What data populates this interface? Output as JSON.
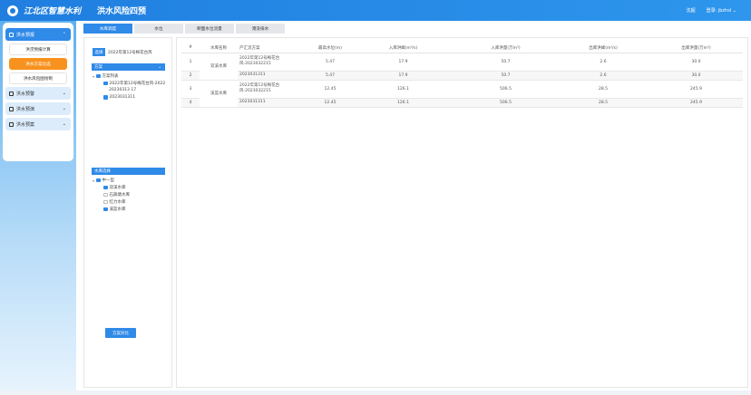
{
  "header": {
    "brand": "江北区智慧水利",
    "system": "洪水风险四预",
    "user_label": "沈超",
    "logout": "登录: jbzhsl"
  },
  "sidebar": [
    {
      "label": "洪水预报",
      "children": [
        "洪涝预报计算",
        "洪水方案比选",
        "洪水风险图绘制"
      ]
    },
    {
      "label": "洪水预警"
    },
    {
      "label": "洪水预演"
    },
    {
      "label": "洪水预案"
    }
  ],
  "tabs": [
    "水库调度",
    "水位",
    "断面水位流量",
    "淹没排水"
  ],
  "left": {
    "select_btn": "选择",
    "select_value": "2022年第12号梅花台风",
    "section1": "方案",
    "tree1_root": "方案列表",
    "tree1_items": [
      "2022年第12号梅花台风-2022",
      "20230313 17",
      "2023031311"
    ],
    "section2": "水库选择",
    "tree2_root": "中一型",
    "tree2_items": [
      "双溪水库",
      "石蔬塘水库",
      "红力水库",
      "溪篮水库"
    ],
    "compare_button": "方案对比"
  },
  "table": {
    "headers": [
      "#",
      "水库名称",
      "产汇流方案",
      "最高水位(m)",
      "入库洪峰(m³/s)",
      "入库洪量(万m³)",
      "出库洪峰(m³/s)",
      "出库洪量(万m³)"
    ],
    "rows": [
      {
        "idx": "1",
        "reservoir": "双溪水库",
        "scheme": "2022年第12号梅花台风-2023032215",
        "max_level": "5.47",
        "in_peak": "17.9",
        "in_vol": "50.7",
        "out_peak": "2.6",
        "out_vol": "30.0"
      },
      {
        "idx": "2",
        "reservoir": "",
        "scheme": "2023031311",
        "max_level": "5.47",
        "in_peak": "17.9",
        "in_vol": "50.7",
        "out_peak": "2.6",
        "out_vol": "30.0"
      },
      {
        "idx": "3",
        "reservoir": "溪篮水库",
        "scheme": "2022年第12号梅花台风-2023032215",
        "max_level": "12.45",
        "in_peak": "126.1",
        "in_vol": "506.5",
        "out_peak": "28.5",
        "out_vol": "245.9"
      },
      {
        "idx": "4",
        "reservoir": "",
        "scheme": "2023031311",
        "max_level": "12.45",
        "in_peak": "126.1",
        "in_vol": "506.5",
        "out_peak": "28.5",
        "out_vol": "245.9"
      }
    ]
  }
}
